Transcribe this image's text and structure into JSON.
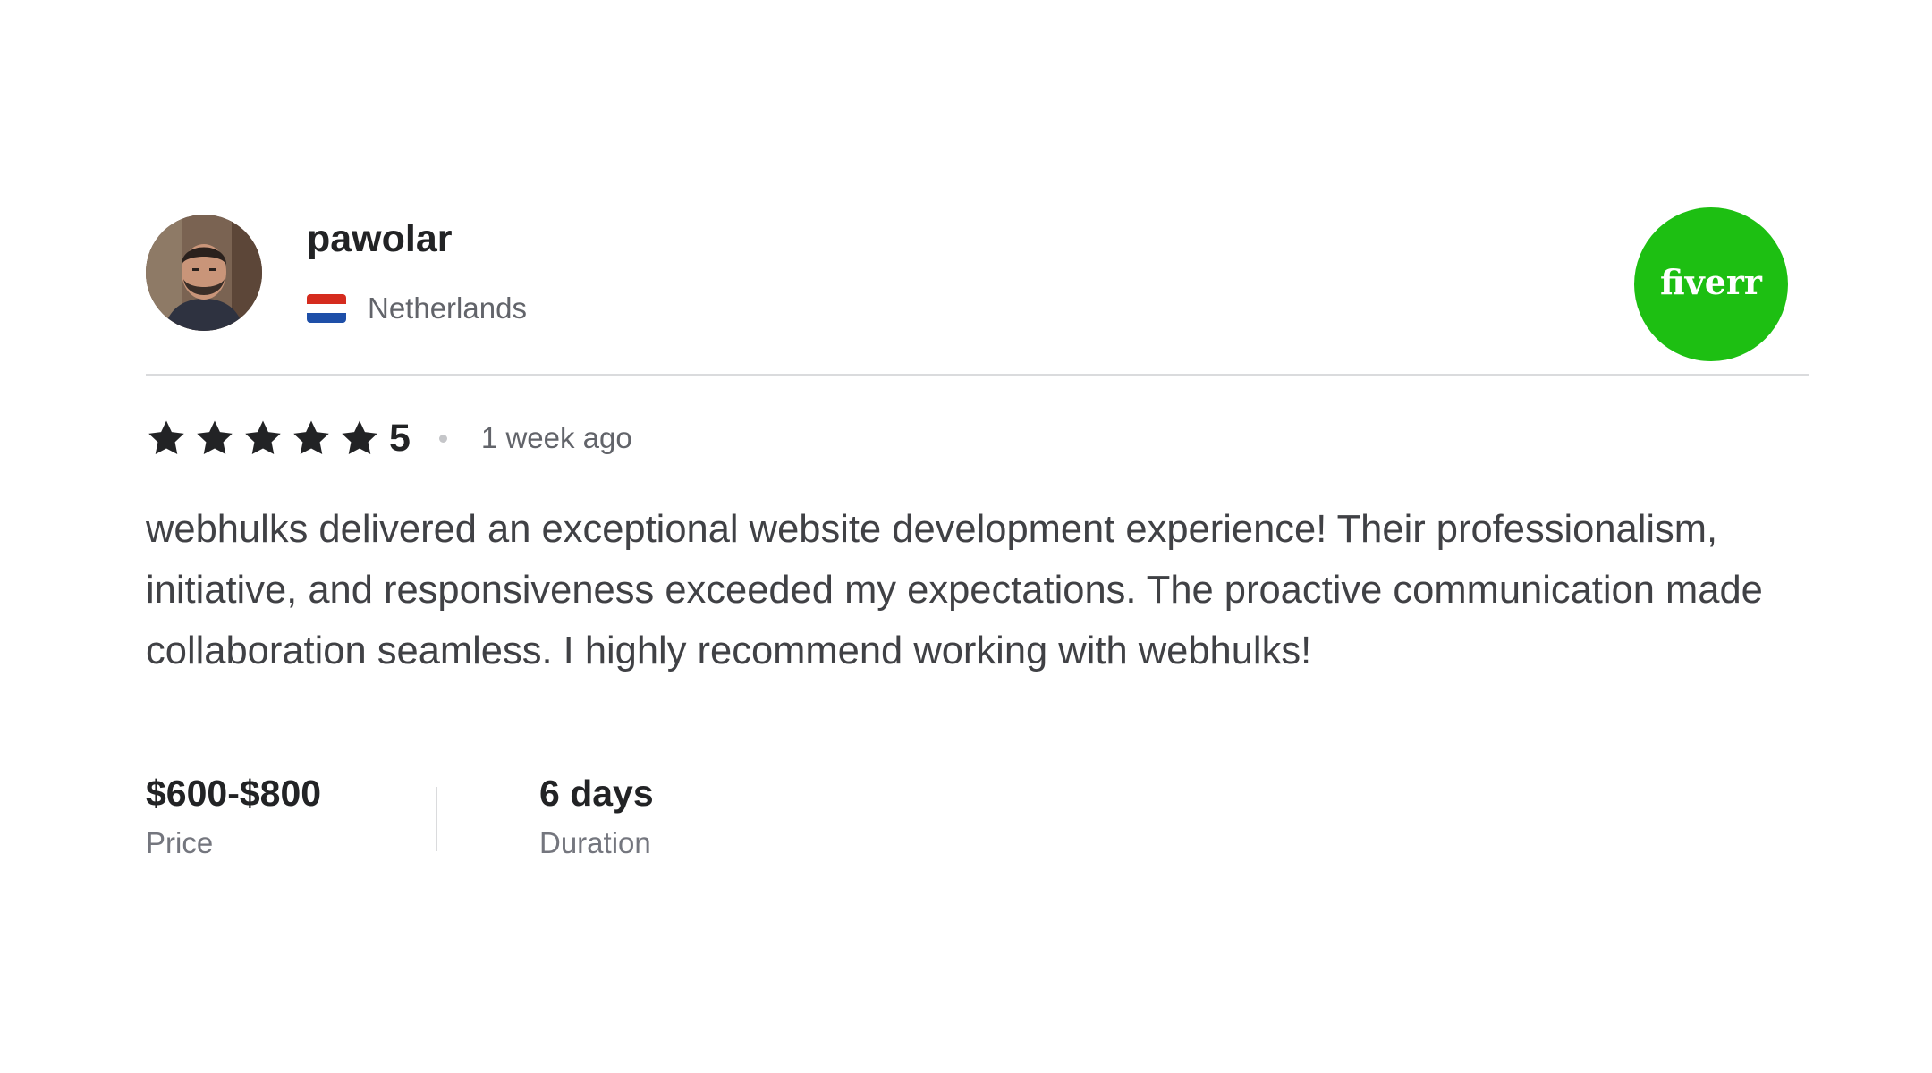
{
  "reviewer": {
    "name": "pawolar",
    "country": "Netherlands",
    "flag_colors": [
      "#d52b1e",
      "#ffffff",
      "#1e4fa8"
    ]
  },
  "brand": {
    "logo_text": "fiverr",
    "color": "#1dbf12"
  },
  "review": {
    "stars": 5,
    "rating_value": "5",
    "time_ago": "1 week ago",
    "text": "webhulks delivered an exceptional website development experience! Their professionalism, initiative, and responsiveness exceeded my expectations. The proactive communication made collaboration seamless. I highly recommend working with webhulks!"
  },
  "stats": {
    "price_value": "$600-$800",
    "price_label": "Price",
    "duration_value": "6 days",
    "duration_label": "Duration"
  }
}
